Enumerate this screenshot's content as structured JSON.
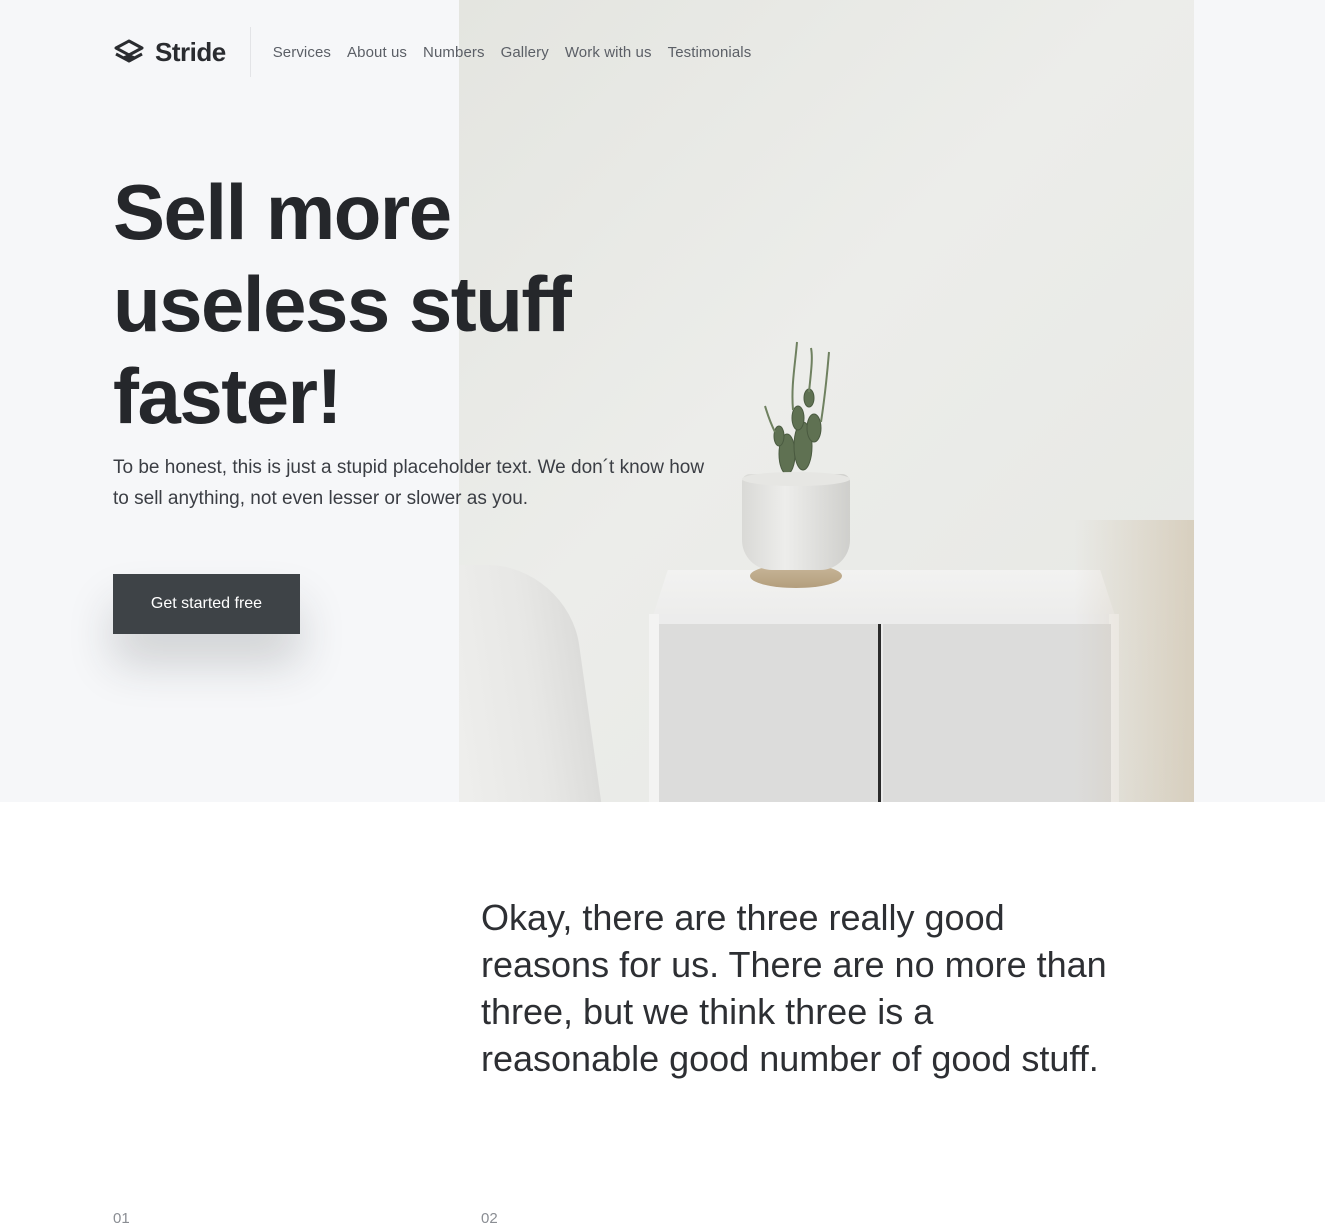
{
  "brand": {
    "name": "Stride",
    "icon": "layers-icon"
  },
  "nav": {
    "items": [
      {
        "label": "Services"
      },
      {
        "label": "About us"
      },
      {
        "label": "Numbers"
      },
      {
        "label": "Gallery"
      },
      {
        "label": "Work with us"
      },
      {
        "label": "Testimonials"
      }
    ]
  },
  "hero": {
    "title_line1": "Sell more",
    "title_line2": "useless stuff",
    "title_line3": "faster!",
    "subtitle": "To be honest, this is just a stupid placeholder text. We don´t know how to sell anything, not even lesser or slower as you.",
    "cta_label": "Get started free"
  },
  "reasons": {
    "text": "Okay, there are three really good reasons for us. There are no more than three, but we think three is a reasonable good number of good stuff.",
    "numbers": [
      "01",
      "02"
    ]
  },
  "colors": {
    "hero_bg": "#f6f7f9",
    "cta_bg": "#3e4347",
    "text_dark": "#25272b",
    "accent_dot": "#4fb4f0"
  }
}
